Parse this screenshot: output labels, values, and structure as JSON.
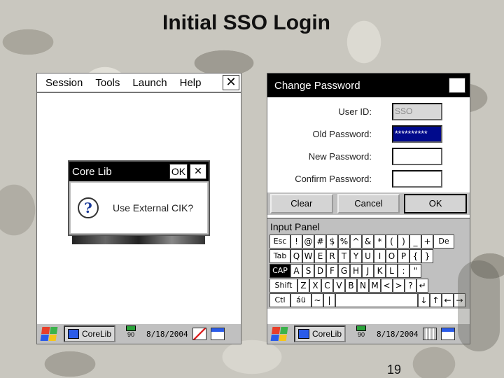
{
  "slide": {
    "title": "Initial SSO Login",
    "page_number": "19"
  },
  "left_screen": {
    "menu": [
      "Session",
      "Tools",
      "Launch",
      "Help"
    ],
    "close_glyph": "✕",
    "dialog": {
      "title": "Core Lib",
      "ok_label": "OK",
      "close_glyph": "✕",
      "icon": "question-icon",
      "icon_glyph": "?",
      "message": "Use External CIK?"
    }
  },
  "right_screen": {
    "dialog_title": "Change Password",
    "close_glyph": "✕",
    "fields": [
      {
        "label": "User ID:",
        "value": "SSO",
        "state": "disabled"
      },
      {
        "label": "Old Password:",
        "value": "**********",
        "state": "selected"
      },
      {
        "label": "New Password:",
        "value": "",
        "state": "normal"
      },
      {
        "label": "Confirm Password:",
        "value": "",
        "state": "normal"
      }
    ],
    "buttons": [
      "Clear",
      "Cancel",
      "OK"
    ],
    "input_panel": {
      "title": "Input Panel",
      "rows": [
        [
          "Esc",
          "!",
          "@",
          "#",
          "$",
          "%",
          "^",
          "&",
          "*",
          "(",
          ")",
          "_",
          "+",
          "De"
        ],
        [
          "Tab",
          "Q",
          "W",
          "E",
          "R",
          "T",
          "Y",
          "U",
          "I",
          "O",
          "P",
          "{",
          "}"
        ],
        [
          "CAP",
          "A",
          "S",
          "D",
          "F",
          "G",
          "H",
          "J",
          "K",
          "L",
          ":",
          "\""
        ],
        [
          "Shift",
          "Z",
          "X",
          "C",
          "V",
          "B",
          "N",
          "M",
          "<",
          ">",
          "?",
          "↵"
        ],
        [
          "Ctl",
          "áü",
          "~",
          "|",
          "",
          "↓",
          "↑",
          "←",
          "→"
        ]
      ]
    }
  },
  "taskbar": {
    "app_label": "CoreLib",
    "battery_label": "90",
    "date": "8/18/2004"
  }
}
